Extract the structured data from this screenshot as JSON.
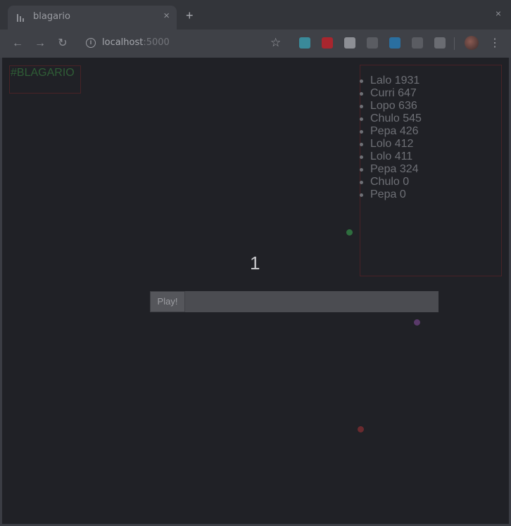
{
  "browser": {
    "tab_title": "blagario",
    "tab_close": "×",
    "new_tab": "+",
    "window_close": "×",
    "back": "←",
    "forward": "→",
    "reload": "↻",
    "info": "i",
    "url_host": "localhost",
    "url_port": ":5000",
    "star": "☆",
    "menu": "⋮",
    "extensions": [
      {
        "name": "lt-extension-icon",
        "color": "#3a8a9a"
      },
      {
        "name": "opera-extension-icon",
        "color": "#a8262e"
      },
      {
        "name": "grid-extension-icon",
        "color": "#8d8f95"
      },
      {
        "name": "box-extension-icon",
        "color": "#5a5c62"
      },
      {
        "name": "h-extension-icon",
        "color": "#2a6fa0"
      },
      {
        "name": "anchor-extension-icon",
        "color": "#5a5c62"
      },
      {
        "name": "vue-extension-icon",
        "color": "#6a6c72"
      }
    ]
  },
  "page": {
    "title": "#BLAGARIO",
    "counter": "1",
    "play_label": "Play!",
    "name_value": ""
  },
  "leaderboard": [
    "Lalo 1931",
    "Curri 647",
    "Lopo 636",
    "Chulo 545",
    "Pepa 426",
    "Lolo 412",
    "Lolo 411",
    "Pepa 324",
    "Chulo 0",
    "Pepa 0"
  ],
  "colors": {
    "background": "#202126",
    "green_blob": "#2e6e3e",
    "purple_blob": "#5a3a6a",
    "red_blob": "#6a2a2e"
  }
}
